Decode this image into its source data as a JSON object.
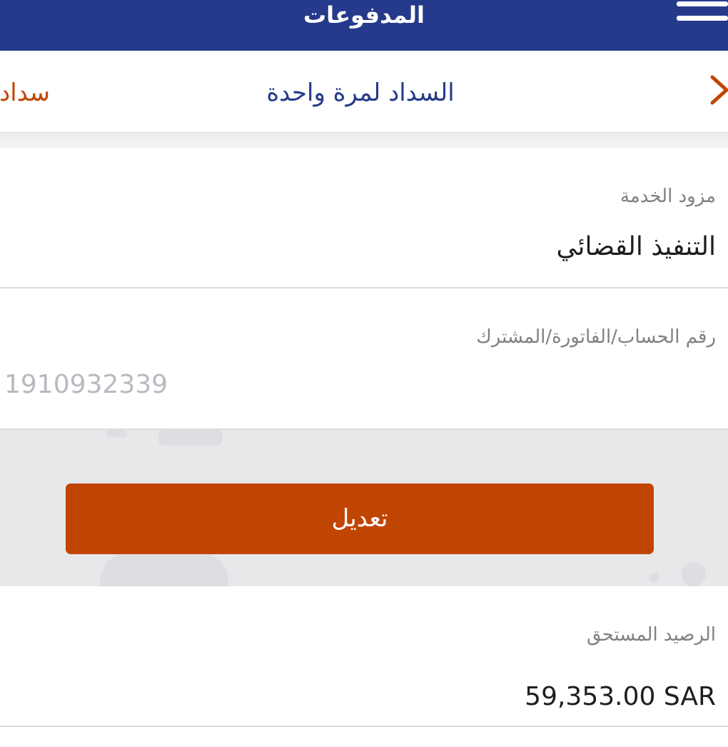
{
  "header": {
    "title": "المدفوعات",
    "menu_icon": "hamburger-menu-icon"
  },
  "tabs": {
    "active_label": "السداد لمرة واحدة",
    "partial_label": "سداد",
    "chevron_icon": "chevron-right-icon"
  },
  "service_provider": {
    "label": "مزود الخدمة",
    "value": "التنفيذ القضائي"
  },
  "account_number": {
    "label": "رقم الحساب/الفاتورة/المشترك",
    "value": "1910932339"
  },
  "edit_button": {
    "label": "تعديل"
  },
  "balance": {
    "label": "الرصيد المستحق",
    "value": "59,353.00 SAR"
  },
  "colors": {
    "header_bg": "#263a8c",
    "accent_orange": "#c14502",
    "tab_blue": "#253a8a"
  }
}
